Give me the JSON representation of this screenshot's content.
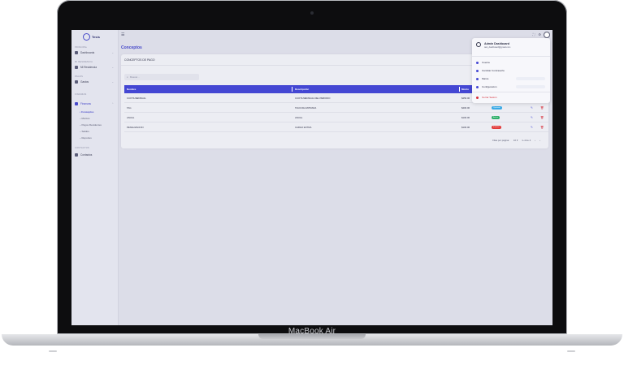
{
  "device": {
    "label": "MacBook Air"
  },
  "app": {
    "logo_text": "Tesis"
  },
  "sidebar": {
    "sections": [
      {
        "label": "PRINCIPAL"
      },
      {
        "label": "MI RESIDENCIA"
      },
      {
        "label": "PAGOS"
      },
      {
        "label": "FINANZAS"
      },
      {
        "label": "CONTACTOS"
      }
    ],
    "items": [
      {
        "label": "Dashboards"
      },
      {
        "label": "Mi Residencia"
      },
      {
        "label": "Gastos"
      },
      {
        "label": "Finanzas"
      },
      {
        "label": "Contactos"
      }
    ],
    "subitems": [
      {
        "label": "Conceptos"
      },
      {
        "label": "Montos"
      },
      {
        "label": "Pagos Residentes"
      },
      {
        "label": "Saldos"
      },
      {
        "label": "Reportes"
      }
    ]
  },
  "page": {
    "title": "Conceptos"
  },
  "card": {
    "title": "CONCEPTOS DE PAGO",
    "search_placeholder": "Buscar...",
    "columns": [
      "Nombre",
      "Descripción",
      "Monto"
    ],
    "rows": [
      {
        "name": "CUOTA MENSUAL",
        "desc": "CUOTA MENSUAL DEL PERIODO",
        "amount": "$450.00",
        "status": "",
        "status_color": ""
      },
      {
        "name": "TAG",
        "desc": "TAGS DE ENTRADA",
        "amount": "$400.00",
        "status": "Opcional",
        "status_color": "#38a9e6"
      },
      {
        "name": "ANUAL",
        "desc": "ANUAL",
        "amount": "$100.00",
        "status": "Activo",
        "status_color": "#2fb06a"
      },
      {
        "name": "PENALIZACION",
        "desc": "CARGO EXTRA",
        "amount": "$100.00",
        "status": "Inactivo",
        "status_color": "#e23b3b"
      }
    ],
    "pager": {
      "rows_label": "Filas por página:",
      "rows_value": "10",
      "range": "1–4 de 4"
    }
  },
  "dropdown": {
    "name": "Admin Dashboard",
    "email": "test_dashboard@gmail.com",
    "items": [
      {
        "label": "Cuenta"
      },
      {
        "label": "Cambiar Contraseña"
      },
      {
        "label": "Marca"
      },
      {
        "label": "Configuración"
      },
      {
        "label": "Cerrar Sesión"
      }
    ]
  },
  "colors": {
    "accent": "#4447d3",
    "danger": "#d62f3a"
  }
}
